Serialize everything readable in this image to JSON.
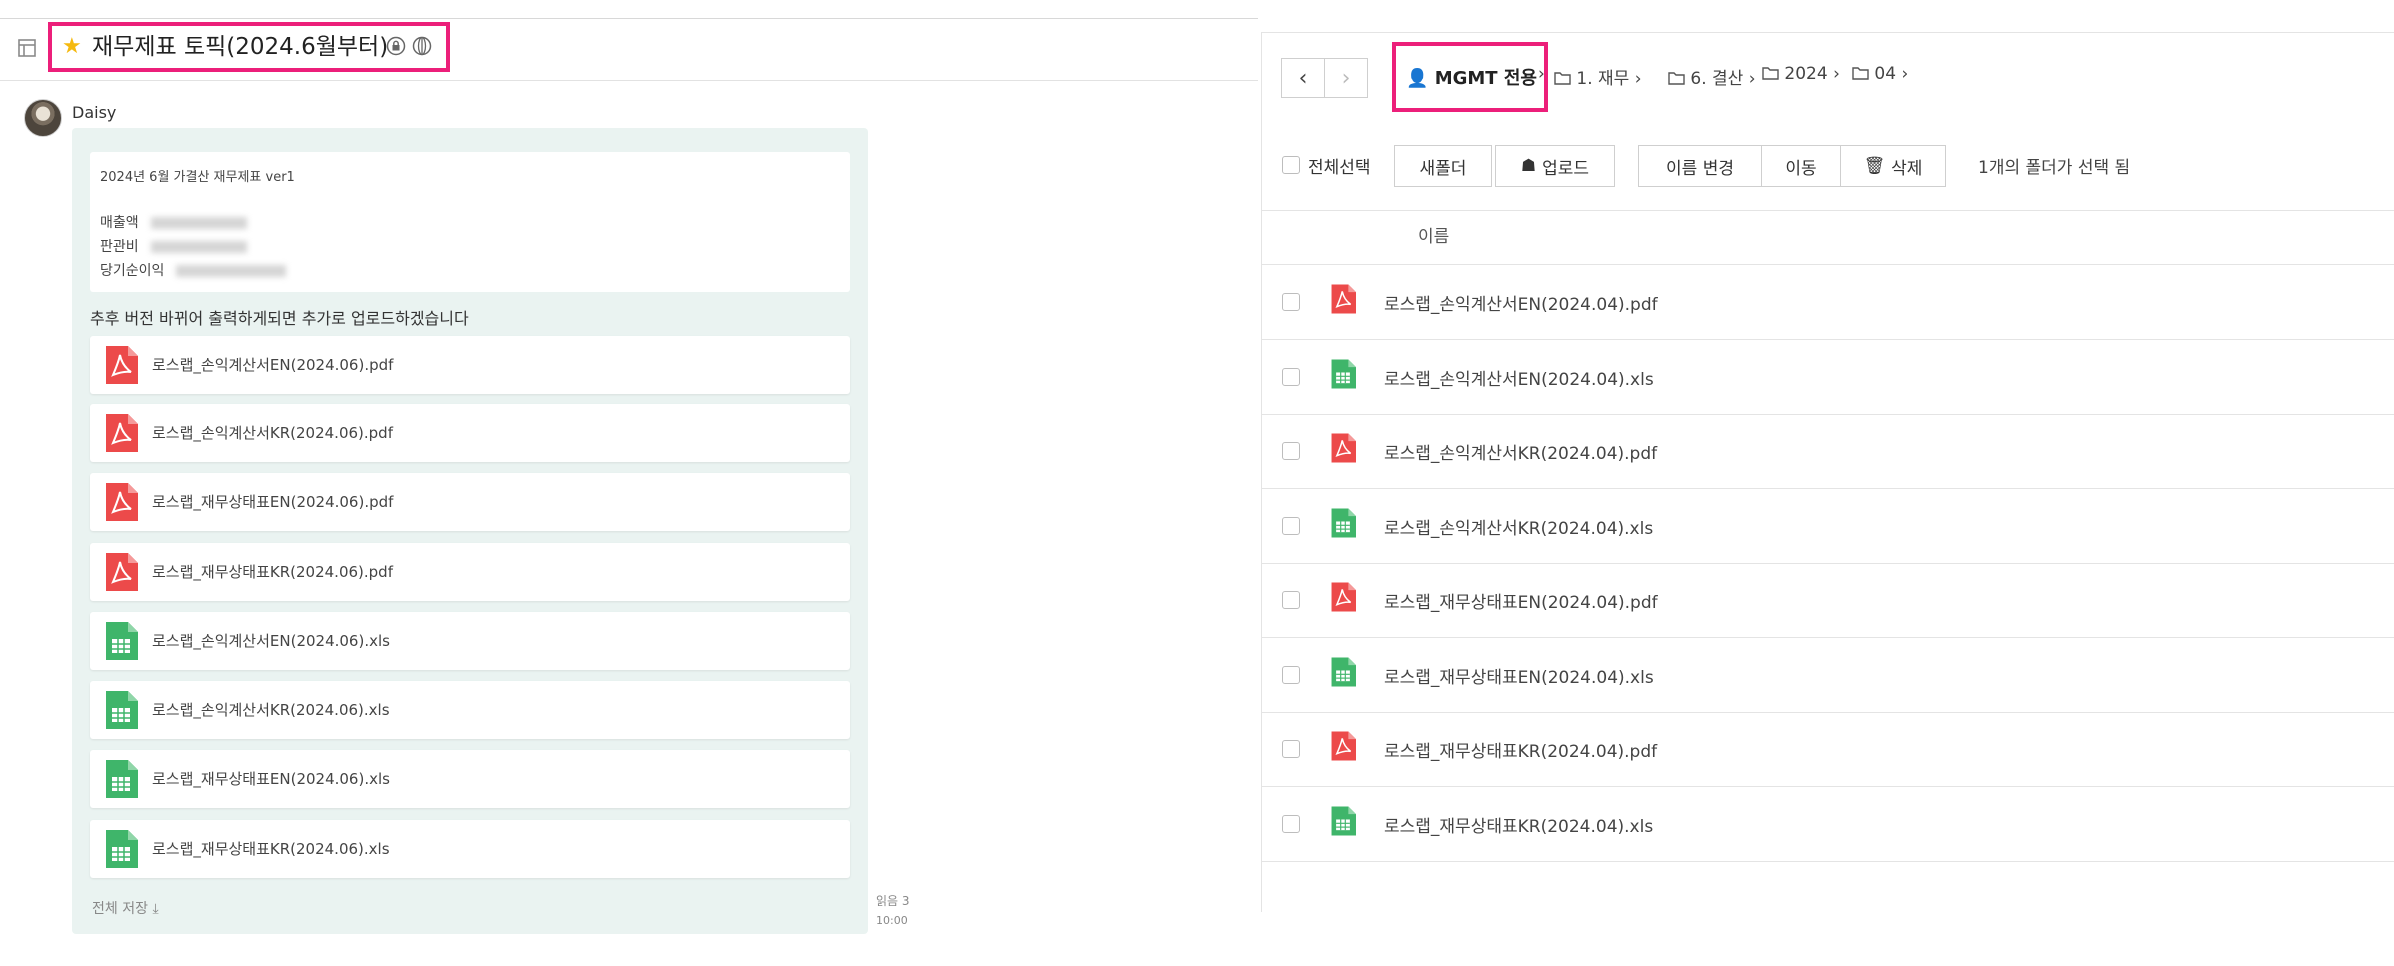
{
  "topic": {
    "title": "재무제표 토픽(2024.6월부터)"
  },
  "message": {
    "sender": "Daisy",
    "post_title": "2024년 6월 가결산 재무제표 ver1",
    "post_lines": [
      {
        "label": "매출액"
      },
      {
        "label": "판관비"
      },
      {
        "label": "당기순이익"
      }
    ],
    "notice": "추후 버전 바뀌어 출력하게되면 추가로 업로드하겠습니다",
    "files": [
      {
        "name": "로스랩_손익계산서EN(2024.06).pdf",
        "type": "pdf"
      },
      {
        "name": "로스랩_손익계산서KR(2024.06).pdf",
        "type": "pdf"
      },
      {
        "name": "로스랩_재무상태표EN(2024.06).pdf",
        "type": "pdf"
      },
      {
        "name": "로스랩_재무상태표KR(2024.06).pdf",
        "type": "pdf"
      },
      {
        "name": "로스랩_손익계산서EN(2024.06).xls",
        "type": "xls"
      },
      {
        "name": "로스랩_손익계산서KR(2024.06).xls",
        "type": "xls"
      },
      {
        "name": "로스랩_재무상태표EN(2024.06).xls",
        "type": "xls"
      },
      {
        "name": "로스랩_재무상태표KR(2024.06).xls",
        "type": "xls"
      }
    ],
    "footer": "전체 저장",
    "read_count": "읽음 3",
    "time": "10:00"
  },
  "drive": {
    "breadcrumb": {
      "root": "MGMT 전용",
      "items": [
        "1. 재무",
        "6. 결산",
        "2024",
        "04"
      ]
    },
    "toolbar": {
      "select_all": "전체선택",
      "new_folder": "새폴더",
      "upload": "업로드",
      "rename": "이름 변경",
      "move": "이동",
      "delete": "삭제",
      "selected_msg": "1개의 폴더가 선택 됨"
    },
    "column_name": "이름",
    "files": [
      {
        "name": "로스랩_손익계산서EN(2024.04).pdf",
        "type": "pdf"
      },
      {
        "name": "로스랩_손익계산서EN(2024.04).xls",
        "type": "xls"
      },
      {
        "name": "로스랩_손익계산서KR(2024.04).pdf",
        "type": "pdf"
      },
      {
        "name": "로스랩_손익계산서KR(2024.04).xls",
        "type": "xls"
      },
      {
        "name": "로스랩_재무상태표EN(2024.04).pdf",
        "type": "pdf"
      },
      {
        "name": "로스랩_재무상태표EN(2024.04).xls",
        "type": "xls"
      },
      {
        "name": "로스랩_재무상태표KR(2024.04).pdf",
        "type": "pdf"
      },
      {
        "name": "로스랩_재무상태표KR(2024.04).xls",
        "type": "xls"
      }
    ]
  },
  "colors": {
    "highlight": "#ec1f7a",
    "pdf": "#ec4a4a",
    "xls": "#3fb56a",
    "star": "#f5b90f"
  }
}
